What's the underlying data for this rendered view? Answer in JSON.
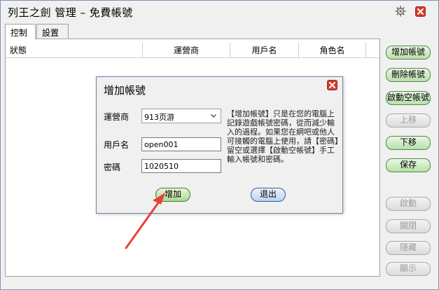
{
  "window": {
    "title": "列王之劍 管理 – 免費帳號"
  },
  "tabs": [
    {
      "label": "控制"
    },
    {
      "label": "設置"
    }
  ],
  "table": {
    "columns": [
      "狀態",
      "運營商",
      "用戶名",
      "角色名"
    ]
  },
  "side_buttons": {
    "add": "增加帳號",
    "delete": "刪除帳號",
    "start_empty": "啟動空帳號",
    "move_up": "上移",
    "move_down": "下移",
    "save": "保存",
    "start": "啟動",
    "close": "關閉",
    "hide": "隱藏",
    "show": "顯示"
  },
  "dialog": {
    "title": "增加帳號",
    "operator_label": "運營商",
    "operator_value": "913页游",
    "username_label": "用戶名",
    "username_value": "open001",
    "password_label": "密碼",
    "password_value": "1020510",
    "note": "【增加帳號】只是在您的電腦上記錄遊戲帳號密碼，從而減少輸入的過程。如果您在網吧或他人可接觸的電腦上使用，請【密碼】留空或選擇【啟動空帳號】手工輸入帳號和密碼。",
    "add_button": "增加",
    "exit_button": "退出"
  },
  "colors": {
    "annotation_arrow": "#e8403a",
    "close_red": "#d33b2b",
    "button_green": "#a8d88d"
  }
}
